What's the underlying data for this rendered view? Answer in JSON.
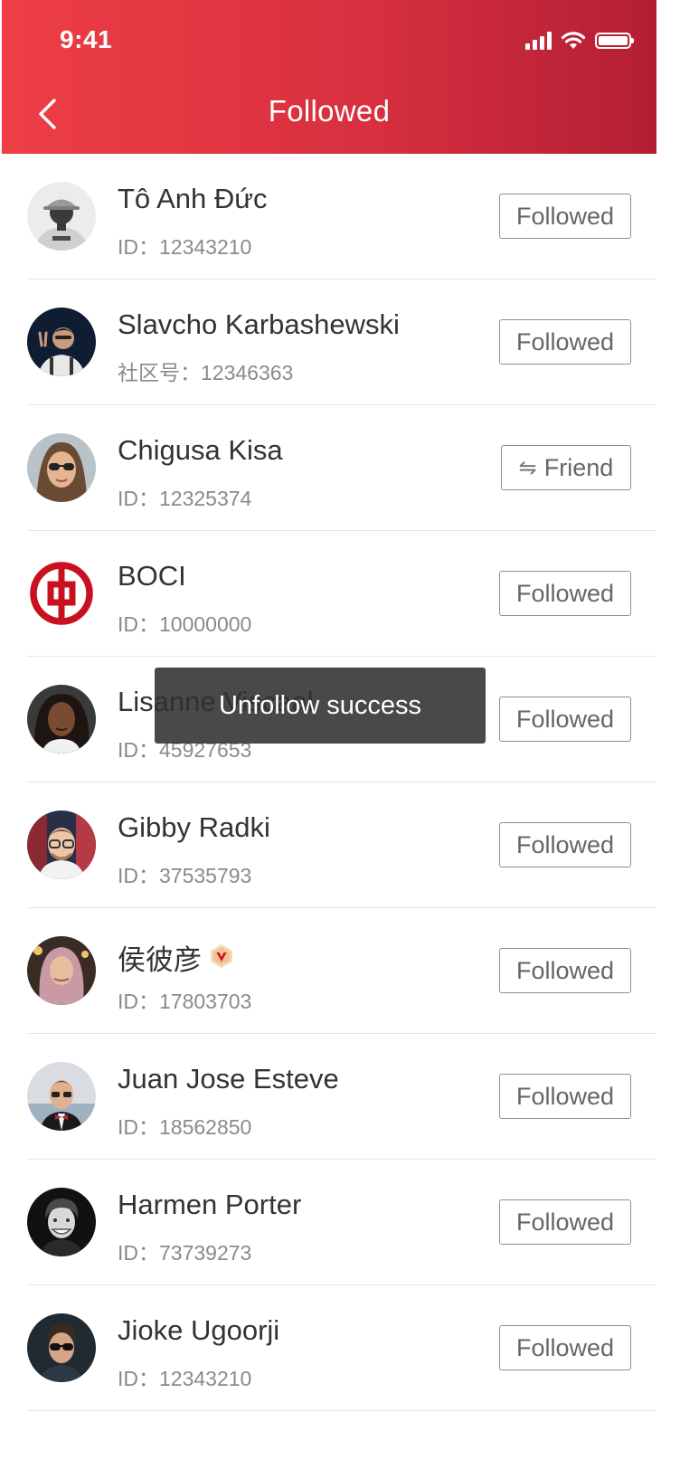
{
  "status_bar": {
    "time": "9:41"
  },
  "header": {
    "title": "Followed"
  },
  "users": [
    {
      "name": "Tô Anh Đức",
      "id_text": "ID：12343210",
      "button": "Followed",
      "avatar": "man-hat"
    },
    {
      "name": "Slavcho Karbashewski",
      "id_text": "社区号：12346363",
      "button": "Followed",
      "avatar": "man-peace"
    },
    {
      "name": "Chigusa Kisa",
      "id_text": "ID：12325374",
      "button": "Friend",
      "avatar": "woman-sunglasses"
    },
    {
      "name": "BOCI",
      "id_text": "ID：10000000",
      "button": "Followed",
      "avatar": "boc-logo"
    },
    {
      "name": "Lisanne Viscaal",
      "id_text": "ID：45927653",
      "button": "Followed",
      "avatar": "woman-curly"
    },
    {
      "name": "Gibby Radki",
      "id_text": "ID：37535793",
      "button": "Followed",
      "avatar": "man-glasses"
    },
    {
      "name": "侯彼彦",
      "id_text": "ID：17803703",
      "button": "Followed",
      "avatar": "woman-hijab",
      "verified": true
    },
    {
      "name": "Juan Jose Esteve",
      "id_text": "ID：18562850",
      "button": "Followed",
      "avatar": "man-bowtie"
    },
    {
      "name": "Harmen Porter",
      "id_text": "ID：73739273",
      "button": "Followed",
      "avatar": "man-smile"
    },
    {
      "name": "Jioke Ugoorji",
      "id_text": "ID：12343210",
      "button": "Followed",
      "avatar": "man-shades"
    }
  ],
  "toast": {
    "message": "Unfollow success"
  },
  "colors": {
    "header_start": "#ee3e46",
    "header_end": "#b31e34",
    "brand_red": "#c8101e"
  }
}
